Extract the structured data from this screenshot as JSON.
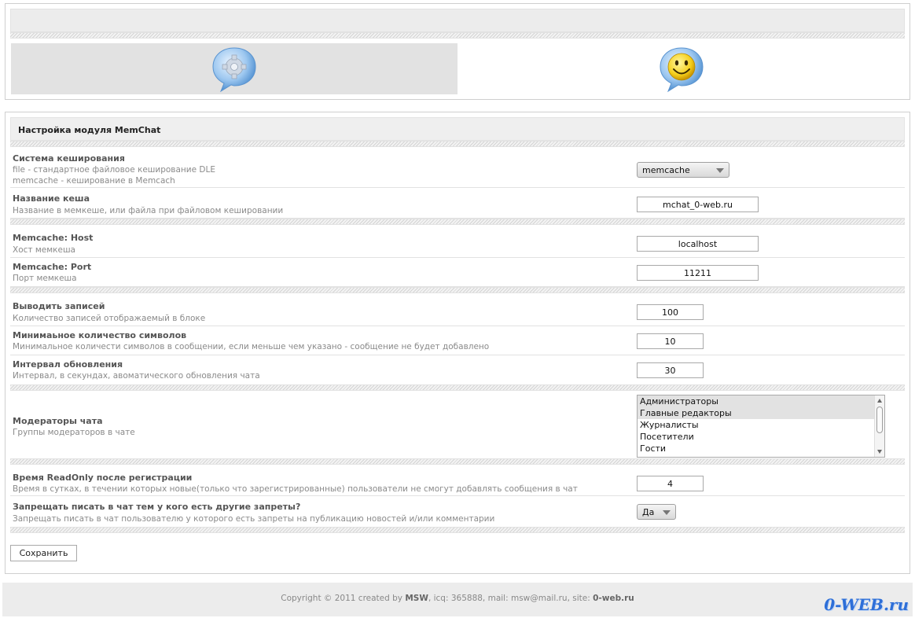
{
  "nav": {
    "settings_icon": "settings-bubble-icon",
    "chat_icon": "smiley-bubble-icon"
  },
  "panel": {
    "title": "Настройка модуля MemChat"
  },
  "settings": {
    "cache_system": {
      "label": "Система кеширования",
      "desc1": "file - стандартное файловое кеширование DLE",
      "desc2": "memcache - кеширование в Memcach",
      "value": "memcache"
    },
    "cache_name": {
      "label": "Название кеша",
      "desc": "Название в мемкеше, или файла при файловом кешировании",
      "value": "mchat_0-web.ru"
    },
    "memcache_host": {
      "label": "Memcache: Host",
      "desc": "Хост мемкеша",
      "value": "localhost"
    },
    "memcache_port": {
      "label": "Memcache: Port",
      "desc": "Порт мемкеша",
      "value": "11211"
    },
    "records": {
      "label": "Выводить записей",
      "desc": "Количество записей отображаемый в блоке",
      "value": "100"
    },
    "min_chars": {
      "label": "Минимаьное количество символов",
      "desc": "Минимальное количести символов в сообщении, если меньше чем указано - сообщение не будет добавлено",
      "value": "10"
    },
    "refresh": {
      "label": "Интервал обновления",
      "desc": "Интервал, в секундах, авоматического обновления чата",
      "value": "30"
    },
    "moderators": {
      "label": "Модераторы чата",
      "desc": "Группы модераторов в чате",
      "options": [
        "Администраторы",
        "Главные редакторы",
        "Журналисты",
        "Посетители",
        "Гости"
      ],
      "selected": [
        "Администраторы",
        "Главные редакторы"
      ]
    },
    "readonly": {
      "label": "Время ReadOnly после регистрации",
      "desc": "Время в сутках, в течении которых новые(только что зарегистрированные) пользователи не смогут добавлять сообщения в чат",
      "value": "4"
    },
    "ban_other": {
      "label": "Запрещать писать в чат тем у кого есть другие запреты?",
      "desc": "Запрещать писать в чат пользователю у которого есть запреты на публикацию новостей и/или комментарии",
      "value": "Да"
    }
  },
  "save_label": "Сохранить",
  "footer": {
    "prefix": "Copyright © 2011 created by ",
    "author": "MSW",
    "middle": ", icq: 365888, mail: msw@mail.ru, site: ",
    "site": "0-web.ru"
  },
  "brand": "0-WEB.ru",
  "colors": {
    "brand": "#2e6fd8",
    "selected_option": "#e2e2e2"
  }
}
